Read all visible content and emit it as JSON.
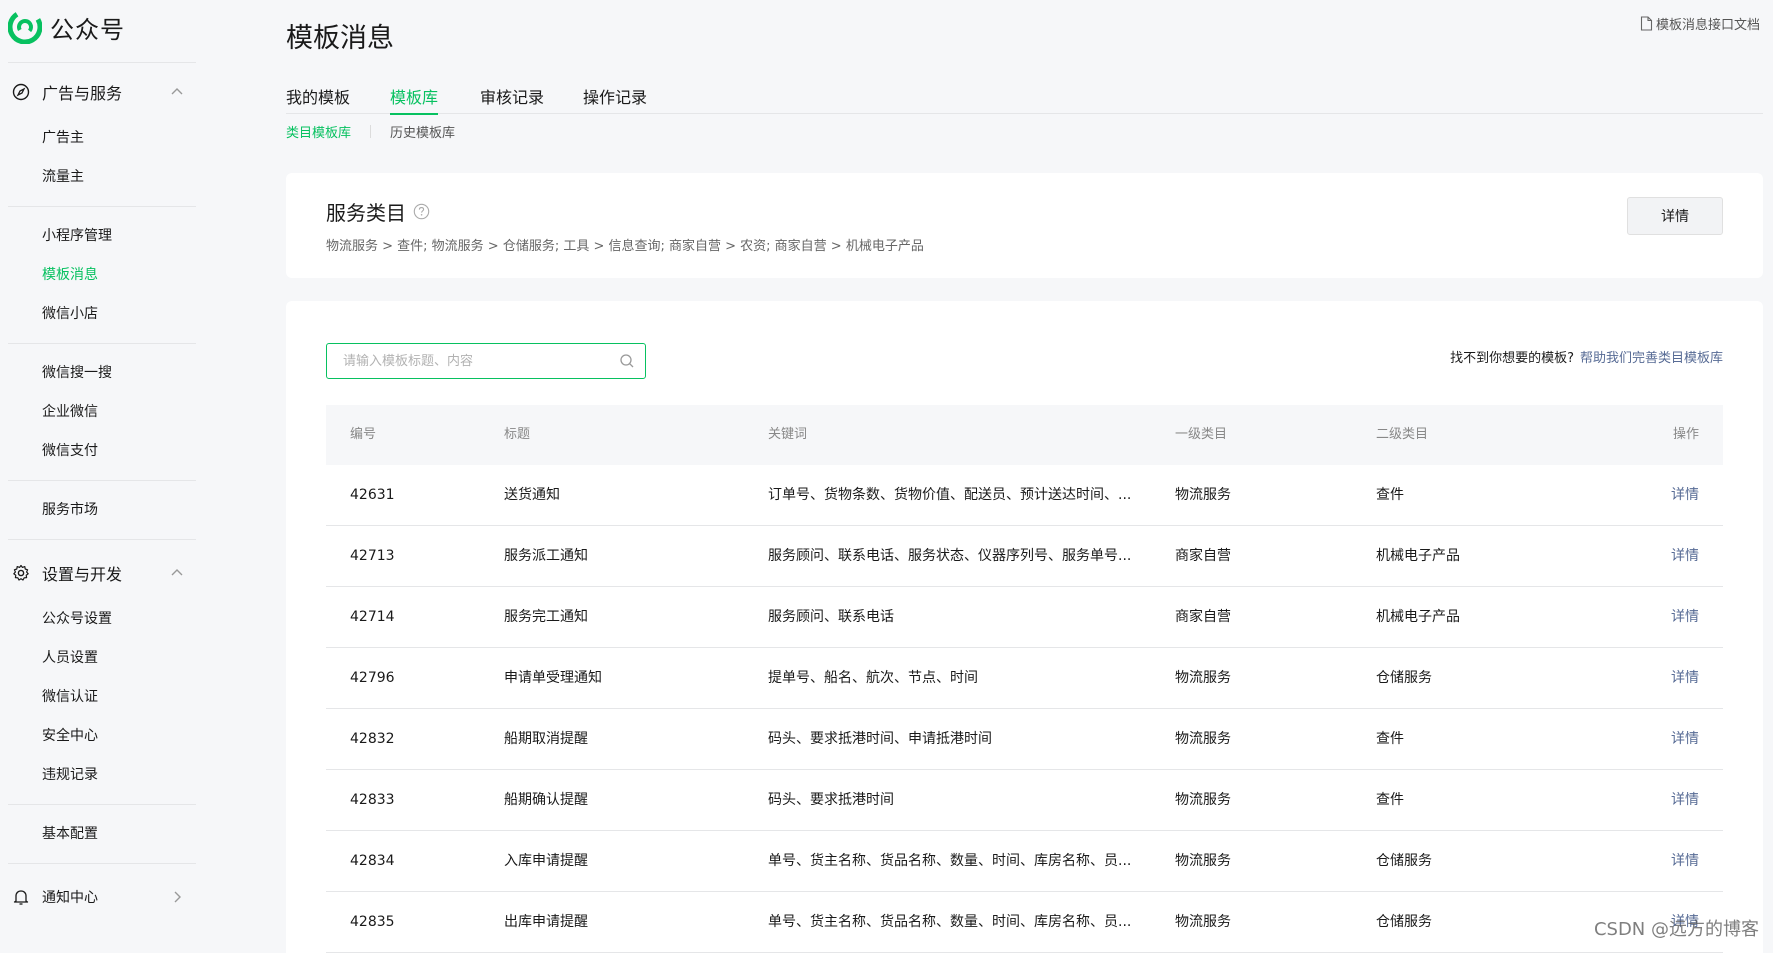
{
  "brand": {
    "name": "公众号",
    "accent": "#07c160",
    "link": "#576b95"
  },
  "sidebar": {
    "group_ads": {
      "label": "广告与服务",
      "icon": "compass-icon"
    },
    "ads_items": [
      "广告主",
      "流量主"
    ],
    "tools_items": [
      "小程序管理",
      "模板消息",
      "微信小店"
    ],
    "other_items": [
      "微信搜一搜",
      "企业微信",
      "微信支付"
    ],
    "market_item": "服务市场",
    "group_settings": {
      "label": "设置与开发",
      "icon": "gear-icon"
    },
    "settings_items": [
      "公众号设置",
      "人员设置",
      "微信认证",
      "安全中心",
      "违规记录"
    ],
    "basic_item": "基本配置",
    "notice": {
      "label": "通知中心",
      "icon": "bell-icon"
    }
  },
  "header": {
    "title": "模板消息",
    "doc_link": "模板消息接口文档"
  },
  "tabs": [
    "我的模板",
    "模板库",
    "审核记录",
    "操作记录"
  ],
  "active_tab": "模板库",
  "subtabs": [
    "类目模板库",
    "历史模板库"
  ],
  "service": {
    "title": "服务类目",
    "path": "物流服务 > 查件; 物流服务 > 仓储服务; 工具 > 信息查询; 商家自营 > 农资; 商家自营 > 机械电子产品",
    "detail_button": "详情"
  },
  "search": {
    "placeholder": "请输入模板标题、内容",
    "value": ""
  },
  "hint": {
    "text": "找不到你想要的模板?",
    "link": "帮助我们完善类目模板库"
  },
  "table": {
    "headers": {
      "id": "编号",
      "title": "标题",
      "keywords": "关键词",
      "level1": "一级类目",
      "level2": "二级类目",
      "op": "操作"
    },
    "rows": [
      {
        "id": "42631",
        "title": "送货通知",
        "keywords": "订单号、货物条数、货物价值、配送员、预计送达时间、...",
        "level1": "物流服务",
        "level2": "查件",
        "op": "详情"
      },
      {
        "id": "42713",
        "title": "服务派工通知",
        "keywords": "服务顾问、联系电话、服务状态、仪器序列号、服务单号...",
        "level1": "商家自营",
        "level2": "机械电子产品",
        "op": "详情"
      },
      {
        "id": "42714",
        "title": "服务完工通知",
        "keywords": "服务顾问、联系电话",
        "level1": "商家自营",
        "level2": "机械电子产品",
        "op": "详情"
      },
      {
        "id": "42796",
        "title": "申请单受理通知",
        "keywords": "提单号、船名、航次、节点、时间",
        "level1": "物流服务",
        "level2": "仓储服务",
        "op": "详情"
      },
      {
        "id": "42832",
        "title": "船期取消提醒",
        "keywords": "码头、要求抵港时间、申请抵港时间",
        "level1": "物流服务",
        "level2": "查件",
        "op": "详情"
      },
      {
        "id": "42833",
        "title": "船期确认提醒",
        "keywords": "码头、要求抵港时间",
        "level1": "物流服务",
        "level2": "查件",
        "op": "详情"
      },
      {
        "id": "42834",
        "title": "入库申请提醒",
        "keywords": "单号、货主名称、货品名称、数量、时间、库房名称、员...",
        "level1": "物流服务",
        "level2": "仓储服务",
        "op": "详情"
      },
      {
        "id": "42835",
        "title": "出库申请提醒",
        "keywords": "单号、货主名称、货品名称、数量、时间、库房名称、员...",
        "level1": "物流服务",
        "level2": "仓储服务",
        "op": "详情"
      }
    ]
  },
  "watermark": "CSDN @远方的博客"
}
